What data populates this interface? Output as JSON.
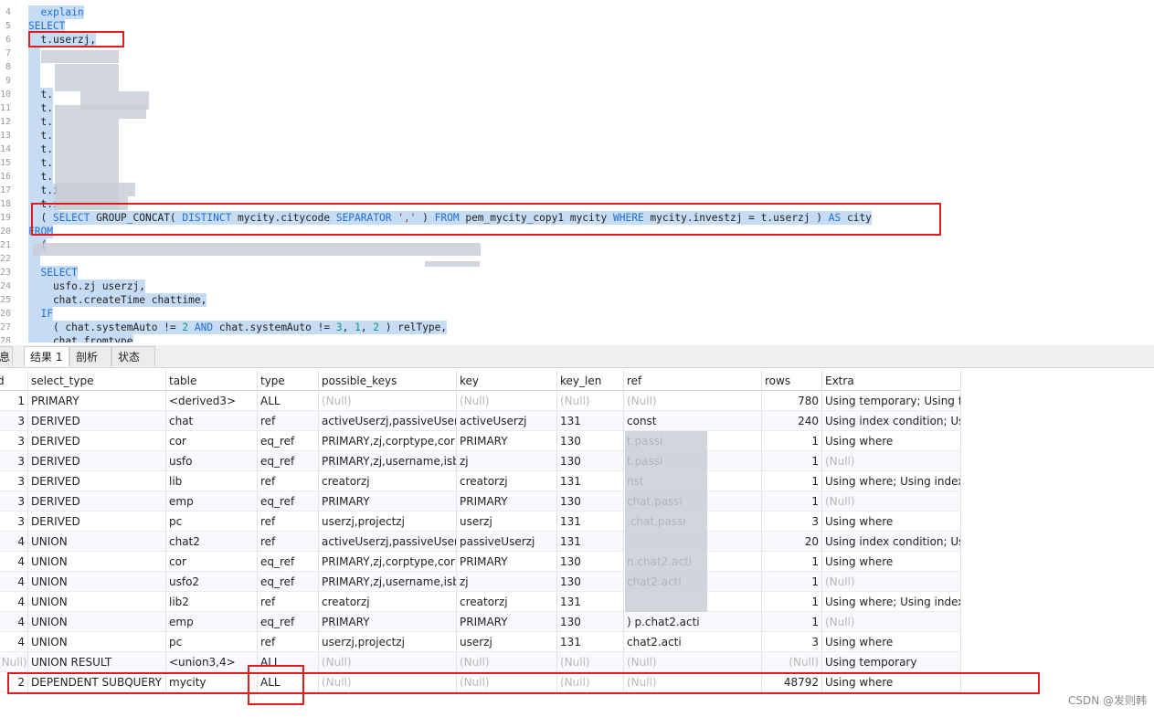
{
  "editor": {
    "lines": [
      {
        "n": "4",
        "sel": true,
        "parts": [
          {
            "t": "  "
          },
          {
            "t": "explain",
            "k": "kw"
          }
        ]
      },
      {
        "n": "5",
        "sel": true,
        "parts": [
          {
            "t": "SELECT",
            "k": "kw"
          }
        ]
      },
      {
        "n": "6",
        "sel": true,
        "parts": [
          {
            "t": "  t.userzj,"
          }
        ]
      },
      {
        "n": "7",
        "sel": true,
        "parts": [
          {
            "t": "  "
          }
        ]
      },
      {
        "n": "8",
        "sel": true,
        "parts": [
          {
            "t": "  "
          }
        ]
      },
      {
        "n": "9",
        "sel": true,
        "parts": [
          {
            "t": "  "
          }
        ]
      },
      {
        "n": "10",
        "sel": true,
        "parts": [
          {
            "t": "  t."
          }
        ]
      },
      {
        "n": "11",
        "sel": true,
        "parts": [
          {
            "t": "  t."
          }
        ]
      },
      {
        "n": "12",
        "sel": true,
        "parts": [
          {
            "t": "  t."
          }
        ]
      },
      {
        "n": "13",
        "sel": true,
        "parts": [
          {
            "t": "  t."
          }
        ]
      },
      {
        "n": "14",
        "sel": true,
        "parts": [
          {
            "t": "  t."
          }
        ]
      },
      {
        "n": "15",
        "sel": true,
        "parts": [
          {
            "t": "  t."
          }
        ]
      },
      {
        "n": "16",
        "sel": true,
        "parts": [
          {
            "t": "  t."
          }
        ]
      },
      {
        "n": "17",
        "sel": true,
        "parts": [
          {
            "t": "  t.i"
          }
        ]
      },
      {
        "n": "18",
        "sel": true,
        "parts": [
          {
            "t": "  t.i"
          }
        ]
      },
      {
        "n": "19",
        "sel": true,
        "parts": [
          {
            "t": "  ( "
          },
          {
            "t": "SELECT",
            "k": "kw"
          },
          {
            "t": " GROUP_CONCAT( "
          },
          {
            "t": "DISTINCT",
            "k": "kw"
          },
          {
            "t": " mycity.citycode "
          },
          {
            "t": "SEPARATOR",
            "k": "kw"
          },
          {
            "t": " "
          },
          {
            "t": "','",
            "k": "str"
          },
          {
            "t": " ) "
          },
          {
            "t": "FROM",
            "k": "kw"
          },
          {
            "t": " pem_mycity_copy1 mycity "
          },
          {
            "t": "WHERE",
            "k": "kw"
          },
          {
            "t": " mycity.investzj = t.userzj ) "
          },
          {
            "t": "AS",
            "k": "kw"
          },
          {
            "t": " city"
          }
        ]
      },
      {
        "n": "20",
        "sel": true,
        "parts": [
          {
            "t": "FROM",
            "k": "kw"
          }
        ]
      },
      {
        "n": "21",
        "sel": true,
        "parts": [
          {
            "t": "  ("
          }
        ]
      },
      {
        "n": "22",
        "sel": true,
        "parts": [
          {
            "t": "  "
          }
        ]
      },
      {
        "n": "23",
        "sel": true,
        "parts": [
          {
            "t": "  "
          },
          {
            "t": "SELECT",
            "k": "kw"
          }
        ]
      },
      {
        "n": "24",
        "sel": true,
        "parts": [
          {
            "t": "    usfo.zj userzj,"
          }
        ]
      },
      {
        "n": "25",
        "sel": true,
        "parts": [
          {
            "t": "    chat.createTime chattime,"
          }
        ]
      },
      {
        "n": "26",
        "sel": true,
        "parts": [
          {
            "t": "  "
          },
          {
            "t": "IF",
            "k": "kw"
          }
        ]
      },
      {
        "n": "27",
        "sel": true,
        "parts": [
          {
            "t": "    ( chat.systemAuto != "
          },
          {
            "t": "2",
            "k": "num"
          },
          {
            "t": " "
          },
          {
            "t": "AND",
            "k": "kw"
          },
          {
            "t": " chat.systemAuto != "
          },
          {
            "t": "3",
            "k": "num"
          },
          {
            "t": ", "
          },
          {
            "t": "1",
            "k": "num"
          },
          {
            "t": ", "
          },
          {
            "t": "2",
            "k": "num"
          },
          {
            "t": " ) relType,"
          }
        ]
      },
      {
        "n": "28",
        "sel": true,
        "parts": [
          {
            "t": "    chat.fromtype"
          }
        ]
      }
    ]
  },
  "tabs": [
    {
      "label": "息",
      "active": false
    },
    {
      "label": "结果 1",
      "active": true
    },
    {
      "label": "剖析",
      "active": false
    },
    {
      "label": "状态",
      "active": false
    }
  ],
  "grid": {
    "columns": [
      "d",
      "select_type",
      "table",
      "type",
      "possible_keys",
      "key",
      "key_len",
      "ref",
      "rows",
      "Extra"
    ],
    "rows": [
      [
        "1",
        "PRIMARY",
        "<derived3>",
        "ALL",
        "(Null)",
        "(Null)",
        "(Null)",
        "(Null)",
        "780",
        "Using temporary; Using fi"
      ],
      [
        "3",
        "DERIVED",
        "chat",
        "ref",
        "activeUserzj,passiveUserz",
        "activeUserzj",
        "131",
        "const",
        "240",
        "Using index condition; Us"
      ],
      [
        "3",
        "DERIVED",
        "cor",
        "eq_ref",
        "PRIMARY,zj,corptype,corp",
        "PRIMARY",
        "130",
        "t.passi",
        "1",
        "Using where"
      ],
      [
        "3",
        "DERIVED",
        "usfo",
        "eq_ref",
        "PRIMARY,zj,username,isba",
        "zj",
        "130",
        "t.passi",
        "1",
        "(Null)"
      ],
      [
        "3",
        "DERIVED",
        "lib",
        "ref",
        "creatorzj",
        "creatorzj",
        "131",
        "nst",
        "1",
        "Using where; Using index"
      ],
      [
        "3",
        "DERIVED",
        "emp",
        "eq_ref",
        "PRIMARY",
        "PRIMARY",
        "130",
        "chat.passi",
        "1",
        "(Null)"
      ],
      [
        "3",
        "DERIVED",
        "pc",
        "ref",
        "userzj,projectzj",
        "userzj",
        "131",
        ".chat.passi",
        "3",
        "Using where"
      ],
      [
        "4",
        "UNION",
        "chat2",
        "ref",
        "activeUserzj,passiveUserz",
        "passiveUserzj",
        "131",
        "",
        "20",
        "Using index condition; Us"
      ],
      [
        "4",
        "UNION",
        "cor",
        "eq_ref",
        "PRIMARY,zj,corptype,corp",
        "PRIMARY",
        "130",
        "n.chat2.acti",
        "1",
        "Using where"
      ],
      [
        "4",
        "UNION",
        "usfo2",
        "eq_ref",
        "PRIMARY,zj,username,isba",
        "zj",
        "130",
        "chat2.acti",
        "1",
        "(Null)"
      ],
      [
        "4",
        "UNION",
        "lib2",
        "ref",
        "creatorzj",
        "creatorzj",
        "131",
        "",
        "1",
        "Using where; Using index"
      ],
      [
        "4",
        "UNION",
        "emp",
        "eq_ref",
        "PRIMARY",
        "PRIMARY",
        "130",
        ") p.chat2.acti",
        "1",
        "(Null)"
      ],
      [
        "4",
        "UNION",
        "pc",
        "ref",
        "userzj,projectzj",
        "userzj",
        "131",
        "chat2.acti",
        "3",
        "Using where"
      ],
      [
        "(Null)",
        "UNION RESULT",
        "<union3,4>",
        "ALL",
        "(Null)",
        "(Null)",
        "(Null)",
        "(Null)",
        "(Null)",
        "Using temporary"
      ],
      [
        "2",
        "DEPENDENT SUBQUERY",
        "mycity",
        "ALL",
        "(Null)",
        "(Null)",
        "(Null)",
        "(Null)",
        "48792",
        "Using where"
      ]
    ]
  },
  "watermark": "CSDN @发则韩"
}
